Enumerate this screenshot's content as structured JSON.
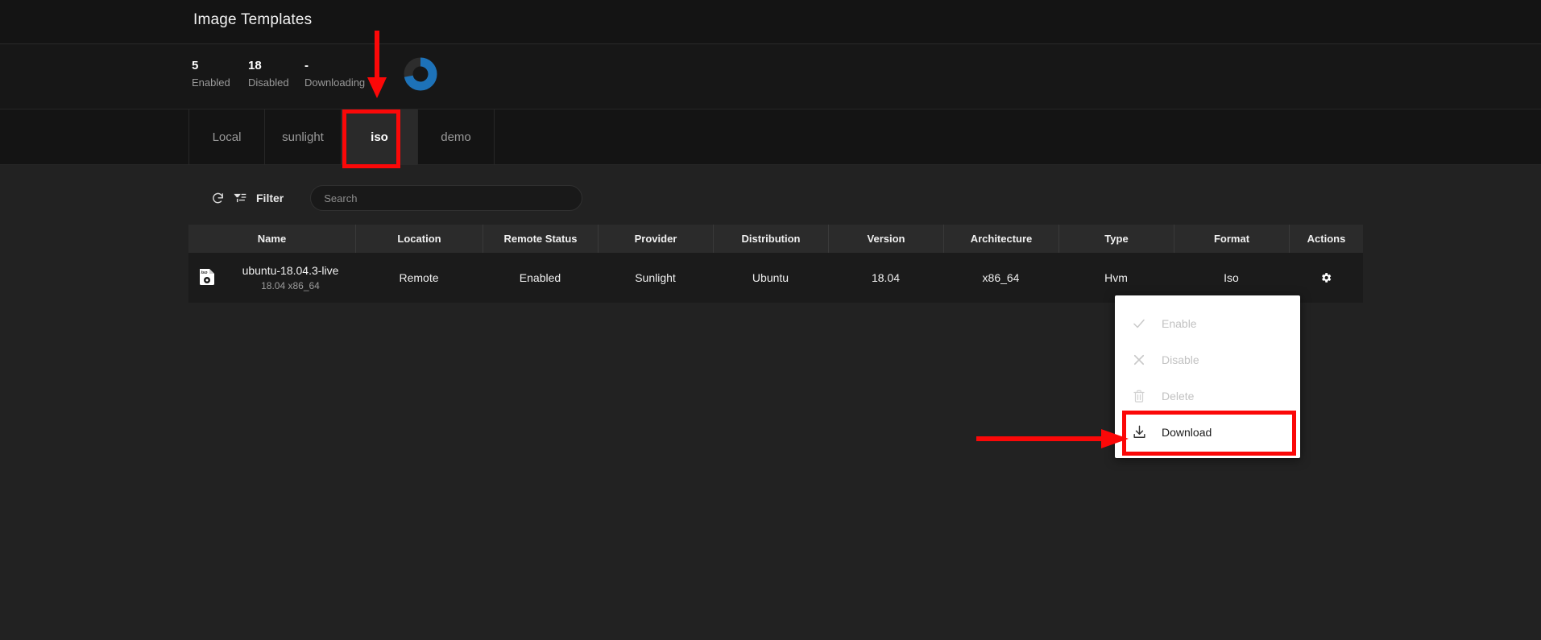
{
  "header": {
    "title": "Image Templates"
  },
  "stats": [
    {
      "value": "5",
      "label": "Enabled"
    },
    {
      "value": "18",
      "label": "Disabled"
    },
    {
      "value": "-",
      "label": "Downloading"
    }
  ],
  "donut": {
    "name": "status-donut-chart",
    "enabled_color": "#1d72b8",
    "disabled_color": "#2a2a2a",
    "enabled_percent": 72,
    "disabled_percent": 28
  },
  "tabs": [
    {
      "label": "Local",
      "active": false
    },
    {
      "label": "sunlight",
      "active": false
    },
    {
      "label": "iso",
      "active": true
    },
    {
      "label": "demo",
      "active": false
    }
  ],
  "toolbar": {
    "refresh_icon": "refresh-icon",
    "filter_icon": "filter-icon",
    "filter_label": "Filter",
    "search_placeholder": "Search",
    "search_value": ""
  },
  "table": {
    "columns": [
      "Name",
      "Location",
      "Remote Status",
      "Provider",
      "Distribution",
      "Version",
      "Architecture",
      "Type",
      "Format",
      "Actions"
    ],
    "rows": [
      {
        "icon": "iso-file-icon",
        "name": "ubuntu-18.04.3-live",
        "name_sub": "18.04 x86_64",
        "location": "Remote",
        "remote_status": "Enabled",
        "provider": "Sunlight",
        "distribution": "Ubuntu",
        "version": "18.04",
        "architecture": "x86_64",
        "type": "Hvm",
        "format": "Iso",
        "actions_icon": "gear-icon"
      }
    ]
  },
  "context_menu": {
    "items": [
      {
        "label": "Enable",
        "icon": "check-icon",
        "disabled": true
      },
      {
        "label": "Disable",
        "icon": "close-x-icon",
        "disabled": true
      },
      {
        "label": "Delete",
        "icon": "trash-icon",
        "disabled": true
      },
      {
        "label": "Download",
        "icon": "download-icon",
        "disabled": false
      }
    ]
  },
  "annotations": {
    "color": "#fb0808",
    "highlight_iso_tab": "iso",
    "highlight_download": "Download"
  }
}
